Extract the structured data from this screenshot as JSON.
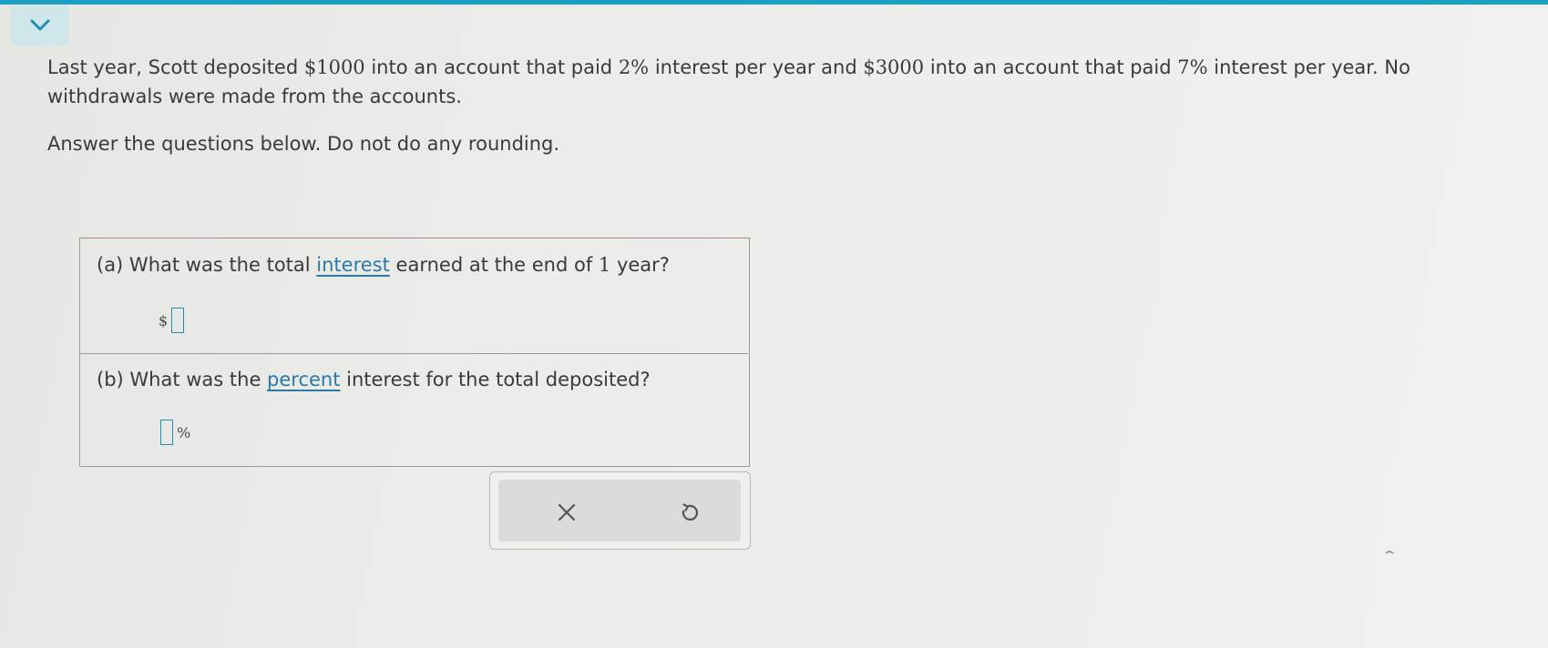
{
  "header": {
    "collapse_icon": "chevron-down-icon",
    "accent_color": "#1aa0c4"
  },
  "problem": {
    "t1": "Last year, Scott deposited ",
    "amount1": "$1000",
    "t2": " into an account that paid ",
    "rate1": "2%",
    "t3": " interest per year and ",
    "amount2": "$3000",
    "t4": " into an account that paid ",
    "rate2": "7%",
    "t5": " interest per year. No withdrawals were made from the accounts."
  },
  "instruction": "Answer the questions below. Do not do any rounding.",
  "question_a": {
    "prefix": "(a) What was the total ",
    "link": "interest",
    "middle": " earned at the end of ",
    "number": "1",
    "suffix": " year?",
    "unit": "$",
    "value": ""
  },
  "question_b": {
    "prefix": "(b) What was the ",
    "link": "percent",
    "suffix": " interest for the total deposited?",
    "unit": "%",
    "value": ""
  },
  "actions": {
    "clear_icon": "close-icon",
    "undo_icon": "undo-icon"
  }
}
